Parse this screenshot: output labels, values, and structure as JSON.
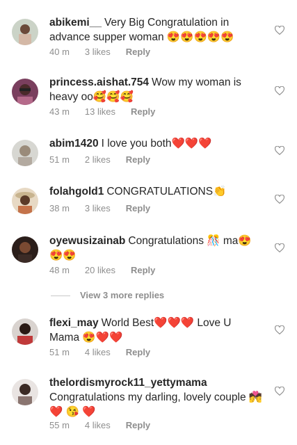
{
  "comments": [
    {
      "username": "abikemi__",
      "text": "Very Big Congratulation in advance supper woman",
      "emoji": "😍😍😍😍😍",
      "time": "40 m",
      "likes": "3 likes",
      "reply": "Reply"
    },
    {
      "username": "princess.aishat.754",
      "text": "Wow my woman is heavy oo",
      "emoji": "🥰🥰🥰",
      "time": "43 m",
      "likes": "13 likes",
      "reply": "Reply"
    },
    {
      "username": "abim1420",
      "text": "I love you both",
      "emoji": "❤️❤️❤️",
      "time": "51 m",
      "likes": "2 likes",
      "reply": "Reply"
    },
    {
      "username": "folahgold1",
      "text": "CONGRATULATIONS",
      "emoji": "👏",
      "time": "38 m",
      "likes": "3 likes",
      "reply": "Reply"
    },
    {
      "username": "oyewusizainab",
      "text": "Congratulations 🎊 ma",
      "emoji": "😍😍😍",
      "time": "48 m",
      "likes": "20 likes",
      "reply": "Reply"
    },
    {
      "username": "flexi_may",
      "text": "World Best❤️❤️❤️ Love U Mama",
      "emoji": "😍❤️❤️",
      "time": "51 m",
      "likes": "4 likes",
      "reply": "Reply"
    },
    {
      "username": "thelordismyrock11_yettymama",
      "text": "Congratulations my darling, lovely couple 💏",
      "emoji": "❤️ 😘 ❤️",
      "time": "55 m",
      "likes": "4 likes",
      "reply": "Reply"
    }
  ],
  "view_more": "View 3 more replies",
  "icons": {
    "like": "heart-outline-icon"
  },
  "colors": {
    "text": "#262626",
    "meta": "#8e8e8e",
    "accent": "#ed4956"
  }
}
